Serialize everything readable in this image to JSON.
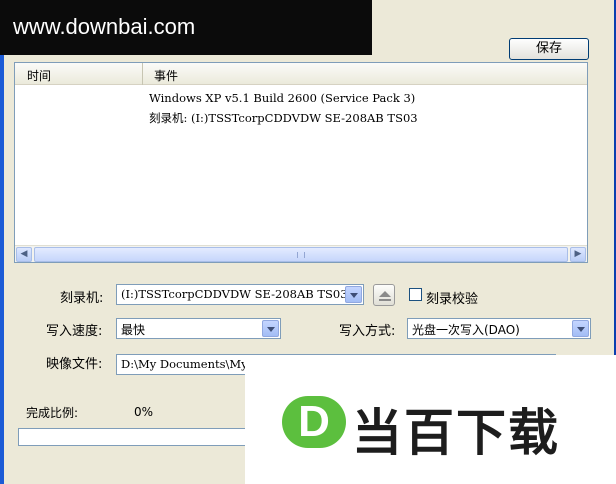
{
  "watermark": {
    "url": "www.downbai.com",
    "brand": "当百下载"
  },
  "toolbar": {
    "save_label": "保存"
  },
  "log": {
    "columns": [
      "时间",
      "事件"
    ],
    "rows": [
      {
        "time": "",
        "event": "Windows XP v5.1 Build 2600 (Service Pack 3)"
      },
      {
        "time": "",
        "event": "刻录机: (I:)TSSTcorpCDDVDW SE-208AB TS03"
      }
    ]
  },
  "form": {
    "recorder_label": "刻录机:",
    "recorder_value": "(I:)TSSTcorpCDDVDW SE-208AB TS03",
    "verify_label": "刻录校验",
    "verify_checked": false,
    "speed_label": "写入速度:",
    "speed_value": "最快",
    "mode_label": "写入方式:",
    "mode_value": "光盘一次写入(DAO)",
    "image_label": "映像文件:",
    "image_value": "D:\\My Documents\\My",
    "progress_label": "完成比例:",
    "progress_value": "0%"
  },
  "icons": {
    "eject": "eject-icon",
    "scroll_left": "arrow-left-icon",
    "scroll_right": "arrow-right-icon"
  }
}
